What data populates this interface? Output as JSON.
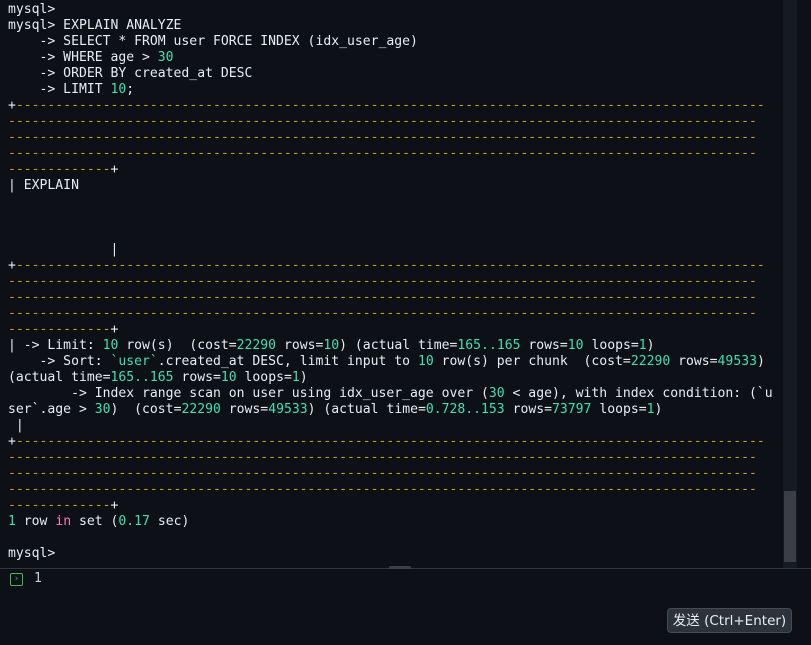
{
  "terminal": {
    "prompt1": "mysql>",
    "query": {
      "l1": "mysql> EXPLAIN ANALYZE",
      "l2": "    -> SELECT * FROM user FORCE INDEX (idx_user_age)",
      "l3a": "    -> WHERE age > ",
      "l3n": "30",
      "l4": "    -> ORDER BY created_at DESC",
      "l5a": "    -> LIMIT ",
      "l5n": "10",
      "l5b": ";"
    },
    "border_full": "-----------------------------------------------------------------------------------------------",
    "border_last": "-------------",
    "explain_header": "| EXPLAIN",
    "cursor_mark": "|",
    "cursor_indent": "             ",
    "plan": {
      "r1a": "| -> Limit: ",
      "r1n1": "10",
      "r1b": " row(s)  (cost=",
      "r1n2": "22290",
      "r1c": " rows=",
      "r1n3": "10",
      "r1d": ") (actual time=",
      "r1n4": "165..165",
      "r1e": " rows=",
      "r1n5": "10",
      "r1f": " loops=",
      "r1n6": "1",
      "r1g": ")",
      "r2a": "    -> Sort: ",
      "r2s": "`user`",
      "r2b": ".created_at DESC, limit input to ",
      "r2n1": "10",
      "r2c": " row(s) per chunk  (cost=",
      "r2n2": "22290",
      "r2d": " rows=",
      "r2n3": "49533",
      "r2e": ")",
      "r3a": "(actual time=",
      "r3n1": "165..165",
      "r3b": " rows=",
      "r3n2": "10",
      "r3c": " loops=",
      "r3n3": "1",
      "r3d": ")",
      "r4a": "        -> Index range scan on user using idx_user_age over (",
      "r4n1": "30",
      "r4b": " < age), with index condition: (`u",
      "r5a": "ser`.age > ",
      "r5n1": "30",
      "r5b": ")  (cost=",
      "r5n2": "22290",
      "r5c": " rows=",
      "r5n3": "49533",
      "r5d": ") (actual time=",
      "r5n4": "0.728..153",
      "r5e": " rows=",
      "r5n5": "73797",
      "r5f": " loops=",
      "r5n6": "1",
      "r5g": ")",
      "r6": " |"
    },
    "result": {
      "n1": "1",
      "a": " row ",
      "kw": "in",
      "b": " set (",
      "n2": "0.17",
      "c": " sec)"
    },
    "prompt_final": "mysql>"
  },
  "editor": {
    "line_number": "1",
    "line_icon": "run-icon"
  },
  "send_button": {
    "label": "发送 (Ctrl+Enter)"
  },
  "colors": {
    "background": "#0d1117",
    "text": "#e6edf3",
    "dash": "#d29922",
    "number": "#3fe0b0",
    "keyword": "#ff7ab0"
  }
}
